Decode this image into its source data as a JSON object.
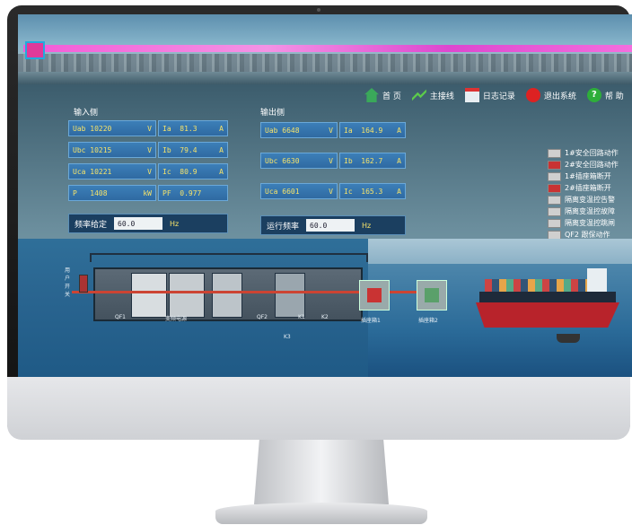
{
  "toolbar": {
    "home": "首 页",
    "main_line": "主接线",
    "log": "日志记录",
    "exit": "退出系统",
    "help": "帮 助"
  },
  "input_side": {
    "title": "输入侧",
    "rows": [
      {
        "l1": "Uab",
        "v1": "10220",
        "u1": "V",
        "l2": "Ia",
        "v2": "81.3",
        "u2": "A"
      },
      {
        "l1": "Ubc",
        "v1": "10215",
        "u1": "V",
        "l2": "Ib",
        "v2": "79.4",
        "u2": "A"
      },
      {
        "l1": "Uca",
        "v1": "10221",
        "u1": "V",
        "l2": "Ic",
        "v2": "80.9",
        "u2": "A"
      },
      {
        "l1": "P",
        "v1": "1408",
        "u1": "kW",
        "l2": "PF",
        "v2": "0.977",
        "u2": ""
      }
    ],
    "freq_label": "频率给定",
    "freq_value": "60.0",
    "freq_unit": "Hz"
  },
  "output_side": {
    "title": "输出侧",
    "rows": [
      {
        "l1": "Uab",
        "v1": "6648",
        "u1": "V",
        "l2": "Ia",
        "v2": "164.9",
        "u2": "A"
      },
      {
        "l1": "Ubc",
        "v1": "6630",
        "u1": "V",
        "l2": "Ib",
        "v2": "162.7",
        "u2": "A"
      },
      {
        "l1": "Uca",
        "v1": "6601",
        "u1": "V",
        "l2": "Ic",
        "v2": "165.3",
        "u2": "A"
      }
    ],
    "freq_label": "运行频率",
    "freq_value": "60.0",
    "freq_unit": "Hz"
  },
  "legend": [
    {
      "label": "1#安全回路动作",
      "color": "#cfcfcf"
    },
    {
      "label": "2#安全回路动作",
      "color": "#c93333"
    },
    {
      "label": "1#插座箱断开",
      "color": "#cfcfcf"
    },
    {
      "label": "2#插座箱断开",
      "color": "#c93333"
    },
    {
      "label": "隔离变温控告警",
      "color": "#cfcfcf"
    },
    {
      "label": "隔离变温控故障",
      "color": "#cfcfcf"
    },
    {
      "label": "隔离变温控跳闸",
      "color": "#cfcfcf"
    },
    {
      "label": "QF2 跟保动作",
      "color": "#cfcfcf"
    }
  ],
  "diagram": {
    "user_switch": "用户开关",
    "qf1": "QF1",
    "converter": "变频电源",
    "qf2": "QF2",
    "k1": "K1",
    "k2": "K2",
    "socket1": "插座箱1",
    "socket2": "插座箱2"
  }
}
